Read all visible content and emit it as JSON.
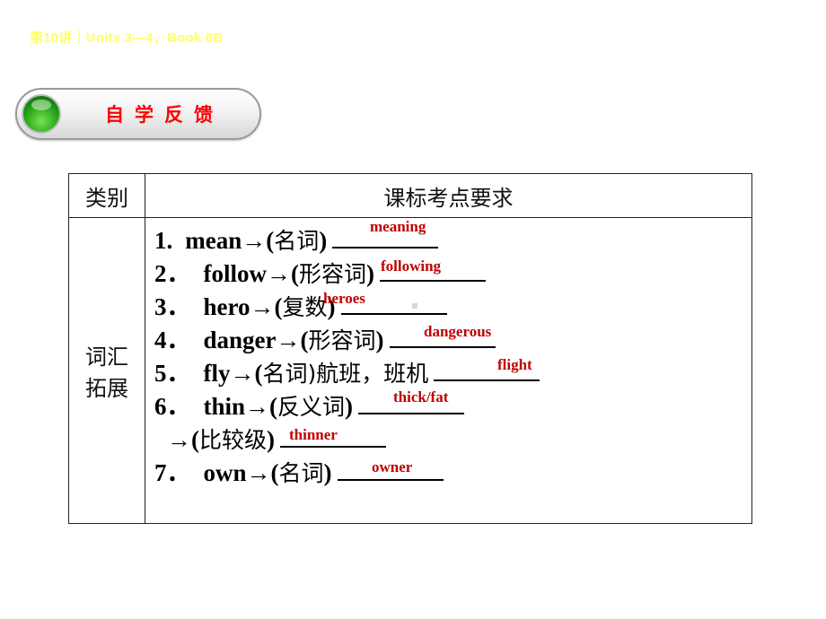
{
  "header": {
    "title": "第10讲｜Units 3—4，Book 8B"
  },
  "section_button": {
    "label": "自学反馈",
    "accent": "#ff0000",
    "ball_color": "#2fae1c"
  },
  "table": {
    "headers": [
      "类别",
      "课标考点要求"
    ],
    "category": "词汇\n拓展",
    "category_lines": [
      "词汇",
      "拓展"
    ],
    "items": [
      {
        "num": "1.",
        "word": "mean→(",
        "hint": "名词",
        "tail": ")",
        "answer": "meaning"
      },
      {
        "num": "2．",
        "word": "follow→(",
        "hint": "形容词",
        "tail": ")",
        "answer": "following"
      },
      {
        "num": "3．",
        "word": "hero→(",
        "hint": "复数",
        "tail": ")",
        "answer": "heroes"
      },
      {
        "num": "4．",
        "word": "danger→(",
        "hint": "形容词",
        "tail": ")",
        "answer": "dangerous"
      },
      {
        "num": "5．",
        "word": "fly→(",
        "hint": "名词",
        "tail": ")航班，班机",
        "answer": "flight"
      },
      {
        "num": "6．",
        "word": "thin→(",
        "hint": "反义词",
        "tail": ")",
        "answer": "thick/fat"
      },
      {
        "num": "",
        "word": "→(",
        "hint": "比较级",
        "tail": ")",
        "answer": "thinner"
      },
      {
        "num": "7．",
        "word": "own→(",
        "hint": "名词",
        "tail": ")",
        "answer": "owner"
      }
    ]
  },
  "colors": {
    "header_text": "#ffff66",
    "answer_text": "#c00000"
  }
}
